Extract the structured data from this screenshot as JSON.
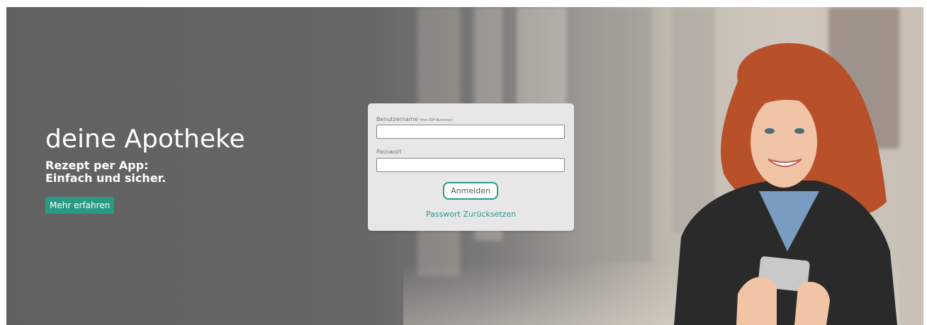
{
  "hero": {
    "title": "deine Apotheke",
    "subtitle_line1": "Rezept per App:",
    "subtitle_line2": "Einfach und sicher.",
    "more_button": "Mehr erfahren"
  },
  "login": {
    "username_label": "Benutzername",
    "username_hint": "(Ihre IDF-Nummer)",
    "username_value": "",
    "password_label": "Passwort",
    "password_value": "",
    "submit_label": "Anmelden",
    "reset_link": "Passwort Zurücksetzen"
  },
  "colors": {
    "accent": "#2b9a85",
    "login_background": "#e7e7e7",
    "hero_text": "#ffffff"
  },
  "image": {
    "semantic": "smiling-woman-with-smartphone-photo"
  }
}
